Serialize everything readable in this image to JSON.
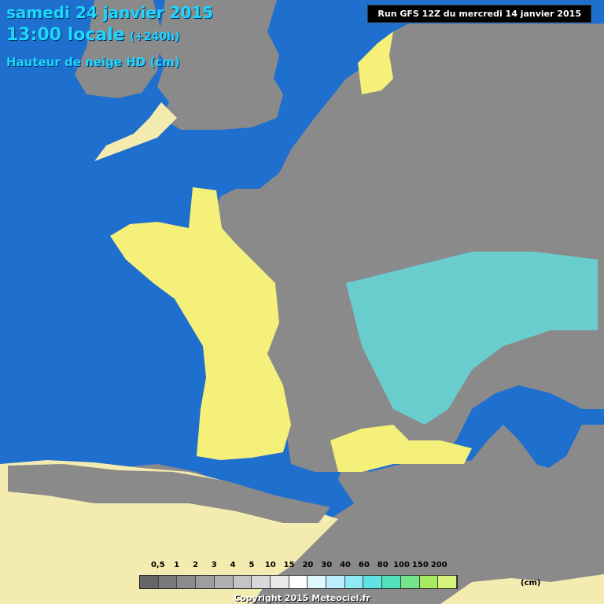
{
  "header": {
    "date": "samedi 24 janvier 2015",
    "time": "13:00 locale",
    "lead": "(+240h)",
    "parameter": "Hauteur de neige HD (cm)"
  },
  "run_info": "Run GFS 12Z du mercredi 14 janvier 2015",
  "legend": {
    "labels": [
      "0,5",
      "1",
      "2",
      "3",
      "4",
      "5",
      "10",
      "15",
      "20",
      "30",
      "40",
      "60",
      "80",
      "100",
      "150",
      "200"
    ],
    "colors": [
      "#666666",
      "#7a7a7a",
      "#8c8c8c",
      "#9e9e9e",
      "#b0b0b0",
      "#c4c4c4",
      "#d8d8d8",
      "#e8e8e8",
      "#ffffff",
      "#dff7ff",
      "#bdf0ff",
      "#8eeaf5",
      "#5fe3e3",
      "#52e0b8",
      "#74e58a",
      "#a6ec62",
      "#d6f27a"
    ],
    "unit": "(cm)"
  },
  "copyright": "Copyright 2015 Meteociel.fr",
  "colors": {
    "sea": "#1f6fcf",
    "land_no_snow": "#f4f07a",
    "land_other": "#f3ebb0",
    "snow_light": "#7f7f7f",
    "snow_deep": "#62e7e6",
    "title": "#1ed7ff"
  }
}
